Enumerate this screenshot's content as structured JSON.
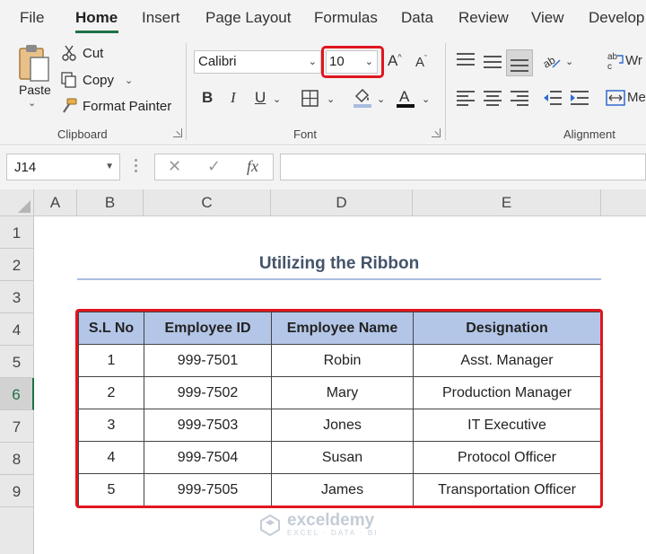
{
  "menu": {
    "tabs": [
      "File",
      "Home",
      "Insert",
      "Page Layout",
      "Formulas",
      "Data",
      "Review",
      "View",
      "Develop"
    ],
    "active": "Home"
  },
  "ribbon": {
    "clipboard": {
      "paste_label": "Paste",
      "cut_label": "Cut",
      "copy_label": "Copy",
      "format_painter_label": "Format Painter",
      "group_label": "Clipboard"
    },
    "font": {
      "font_name": "Calibri",
      "font_size": "10",
      "bold": "B",
      "italic": "I",
      "underline": "U",
      "group_label": "Font"
    },
    "alignment": {
      "wrap_label": "Wr",
      "merge_label": "Me",
      "group_label": "Alignment"
    }
  },
  "formula_bar": {
    "name_box": "J14",
    "cancel_glyph": "✕",
    "enter_glyph": "✓",
    "fx_glyph": "fx",
    "formula": ""
  },
  "grid": {
    "columns": [
      "A",
      "B",
      "C",
      "D",
      "E"
    ],
    "rows": [
      "1",
      "2",
      "3",
      "4",
      "5",
      "6",
      "7",
      "8",
      "9"
    ],
    "selected_row": "6"
  },
  "sheet": {
    "title": "Utilizing the Ribbon",
    "headers": [
      "S.L No",
      "Employee ID",
      "Employee Name",
      "Designation"
    ],
    "rows": [
      [
        "1",
        "999-7501",
        "Robin",
        "Asst. Manager"
      ],
      [
        "2",
        "999-7502",
        "Mary",
        "Production Manager"
      ],
      [
        "3",
        "999-7503",
        "Jones",
        "IT Executive"
      ],
      [
        "4",
        "999-7504",
        "Susan",
        "Protocol Officer"
      ],
      [
        "5",
        "999-7505",
        "James",
        "Transportation Officer"
      ]
    ]
  },
  "watermark": {
    "name": "exceldemy",
    "tagline": "EXCEL · DATA · BI"
  },
  "colors": {
    "accent": "#1e7145",
    "highlight": "#e0161f",
    "header_fill": "#b4c6e7",
    "title_color": "#44546a"
  }
}
